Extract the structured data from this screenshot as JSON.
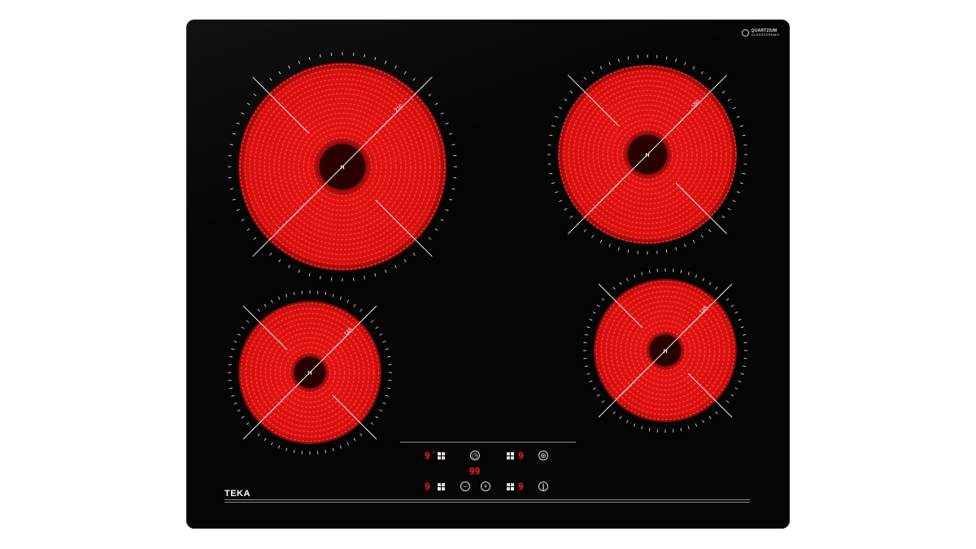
{
  "brand": {
    "name": "TEKA",
    "surface_badge_line1": "QUARTZIUM",
    "surface_badge_line2": "GLASSCERAMIC"
  },
  "colors": {
    "glass": "#050505",
    "heat_red": "#e01212",
    "display_red": "#ff2a1a",
    "print_white": "#e0e0e0"
  },
  "zones": [
    {
      "name": "rear-left",
      "label": "210",
      "center_mark": "H"
    },
    {
      "name": "rear-right",
      "label": "180",
      "center_mark": "H"
    },
    {
      "name": "front-left",
      "label": "145",
      "center_mark": "H"
    },
    {
      "name": "front-right",
      "label": "145",
      "center_mark": "H"
    }
  ],
  "controls": {
    "rear_left_level": "9",
    "rear_right_level": "9",
    "front_left_level": "9",
    "front_right_level": "9",
    "timer_display": "99",
    "timer_icon": "clock-icon",
    "lock_icon": "lock-icon",
    "minus_icon": "minus-icon",
    "plus_icon": "plus-icon",
    "power_icon": "power-icon"
  }
}
